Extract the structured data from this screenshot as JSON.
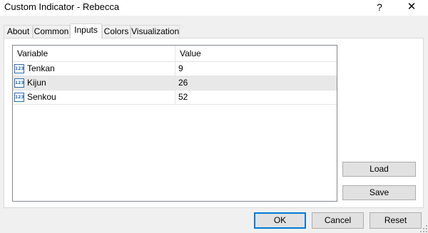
{
  "window": {
    "title": "Custom Indicator - Rebecca",
    "help_symbol": "?",
    "close_symbol": "✕"
  },
  "tabs": [
    {
      "label": "About",
      "active": false
    },
    {
      "label": "Common",
      "active": false
    },
    {
      "label": "Inputs",
      "active": true
    },
    {
      "label": "Colors",
      "active": false
    },
    {
      "label": "Visualization",
      "active": false
    }
  ],
  "inputs_table": {
    "columns": [
      "Variable",
      "Value"
    ],
    "rows": [
      {
        "icon": "number-123-icon",
        "icon_text": "123",
        "variable": "Tenkan",
        "value": "9",
        "selected": false
      },
      {
        "icon": "number-123-icon",
        "icon_text": "123",
        "variable": "Kijun",
        "value": "26",
        "selected": true
      },
      {
        "icon": "number-123-icon",
        "icon_text": "123",
        "variable": "Senkou",
        "value": "52",
        "selected": false
      }
    ]
  },
  "side_buttons": {
    "load": "Load",
    "save": "Save"
  },
  "dialog_buttons": {
    "ok": "OK",
    "cancel": "Cancel",
    "reset": "Reset"
  },
  "colors": {
    "default_button_border": "#0078d7",
    "selected_row": "#e8e8e8"
  }
}
